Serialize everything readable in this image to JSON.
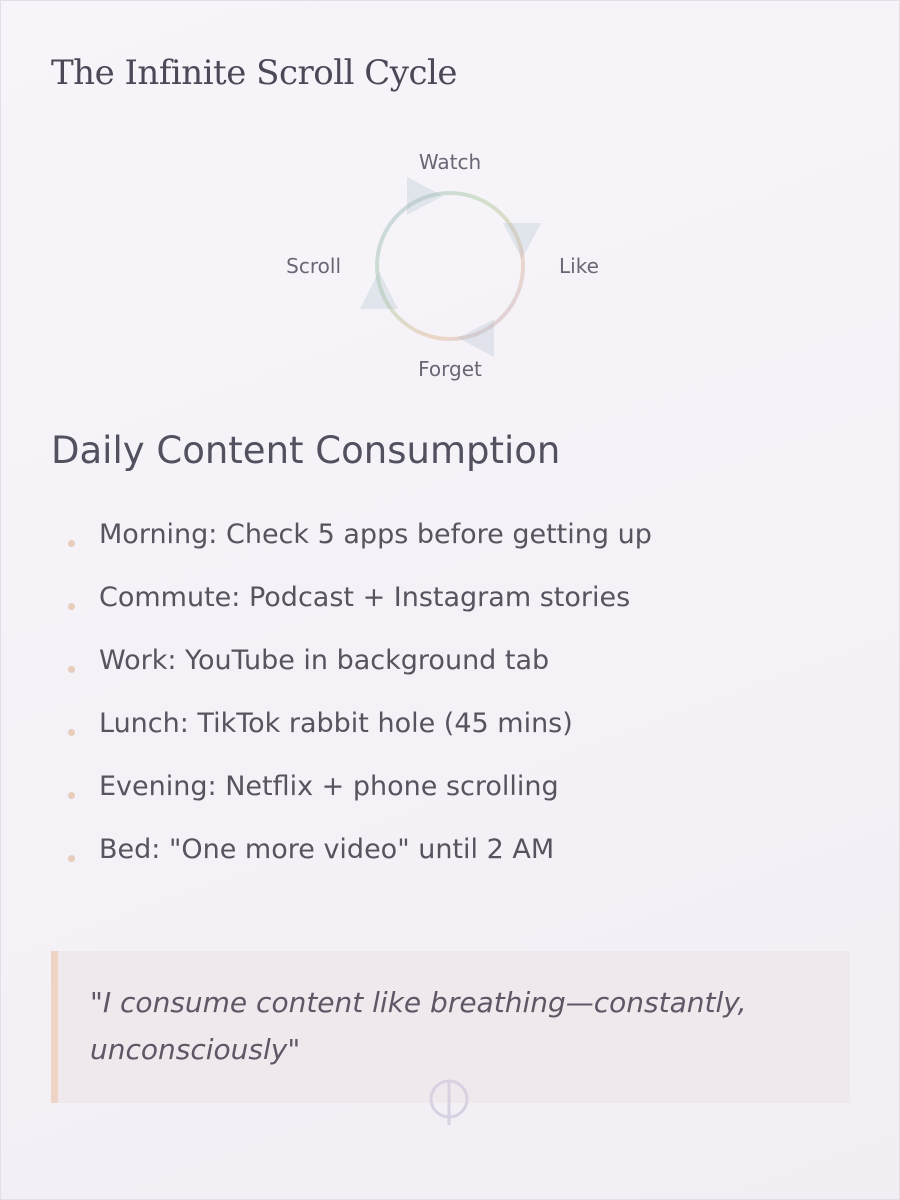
{
  "title": "The Infinite Scroll Cycle",
  "cycle": {
    "stages": [
      {
        "label": "Watch",
        "position": "top",
        "color": "#b8c9d8"
      },
      {
        "label": "Like",
        "position": "right",
        "color": "#c5d4c0"
      },
      {
        "label": "Forget",
        "position": "bottom",
        "color": "#ead2c2"
      },
      {
        "label": "Scroll",
        "position": "left",
        "color": "#d6cce0"
      }
    ],
    "flow": [
      "Watch",
      "Like",
      "Forget",
      "Scroll"
    ]
  },
  "section": {
    "heading": "Daily Content Consumption",
    "items": [
      "Morning: Check 5 apps before getting up",
      "Commute: Podcast + Instagram stories",
      "Work: YouTube in background tab",
      "Lunch: TikTok rabbit hole (45 mins)",
      "Evening: Netflix + phone scrolling",
      "Bed: \"One more video\" until 2 AM"
    ]
  },
  "quote": {
    "text": "\"I consume content like breathing—constantly, unconsciously\""
  },
  "colors": {
    "background": "#f4f2f7",
    "accent": "#e8cdbd",
    "quote_background": "#efe8ec",
    "heading_text": "#53505f"
  }
}
